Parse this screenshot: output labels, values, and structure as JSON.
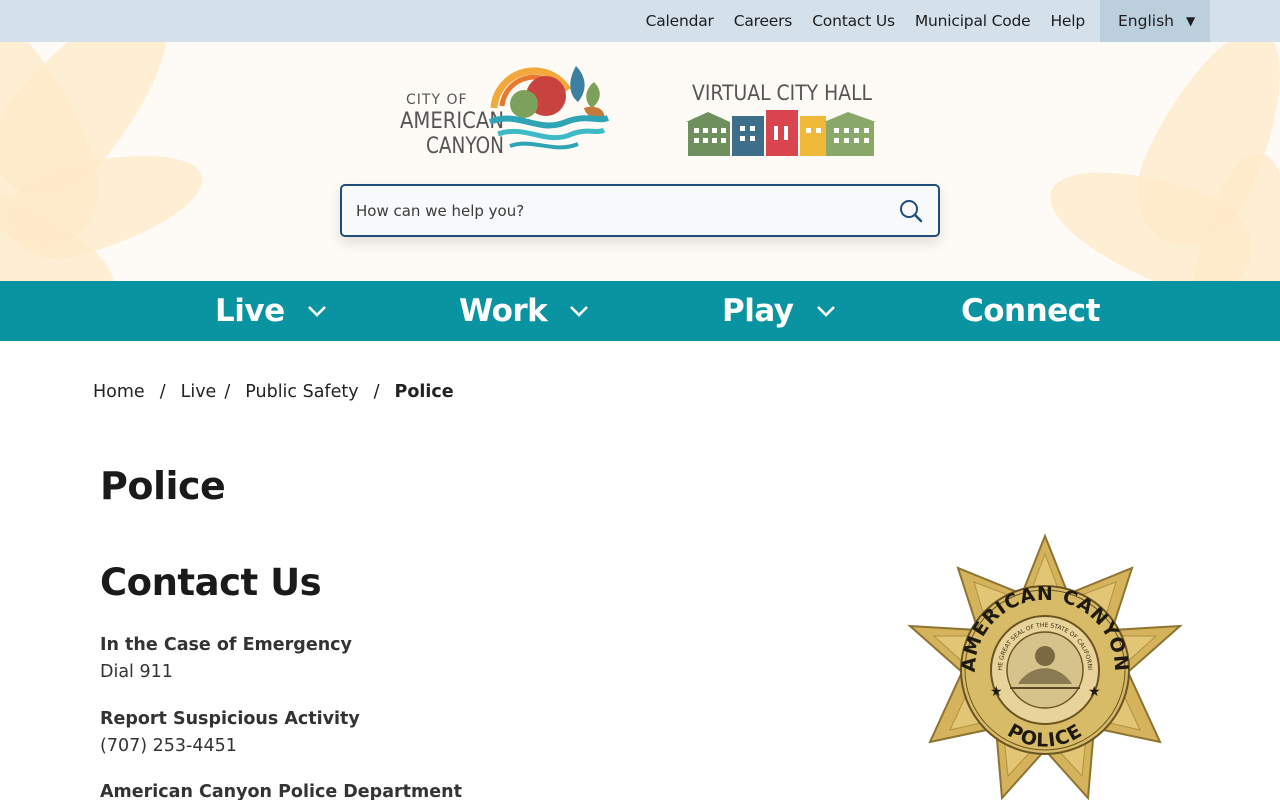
{
  "utility": {
    "links": [
      "Calendar",
      "Careers",
      "Contact Us",
      "Municipal Code",
      "Help"
    ],
    "language": "English"
  },
  "header": {
    "logo_city": {
      "line1": "CITY OF",
      "line2": "AMERICAN",
      "line3": "CANYON"
    },
    "logo_vch": "VIRTUAL CITY HALL",
    "search_placeholder": "How can we help you?"
  },
  "nav": {
    "items": [
      {
        "label": "Live",
        "has_dropdown": true
      },
      {
        "label": "Work",
        "has_dropdown": true
      },
      {
        "label": "Play",
        "has_dropdown": true
      },
      {
        "label": "Connect",
        "has_dropdown": false
      }
    ]
  },
  "breadcrumb": {
    "items": [
      "Home",
      "Live",
      "Public Safety"
    ],
    "separator": "/",
    "current": "Police"
  },
  "page": {
    "title": "Police",
    "section_title": "Contact Us",
    "contacts": [
      {
        "label": "In the Case of Emergency",
        "value": "Dial 911"
      },
      {
        "label": "Report Suspicious Activity",
        "value": "(707) 253-4451"
      },
      {
        "label": "American Canyon Police Department",
        "value": ""
      }
    ]
  },
  "badge": {
    "top_text": "AMERICAN CANYON",
    "bottom_text": "POLICE",
    "seal_text": "THE GREAT SEAL OF THE STATE OF CALIFORNIA"
  },
  "colors": {
    "utility_bg": "#d4e1eb",
    "nav_bg": "#0a93a0",
    "search_border": "#1f4e79"
  }
}
